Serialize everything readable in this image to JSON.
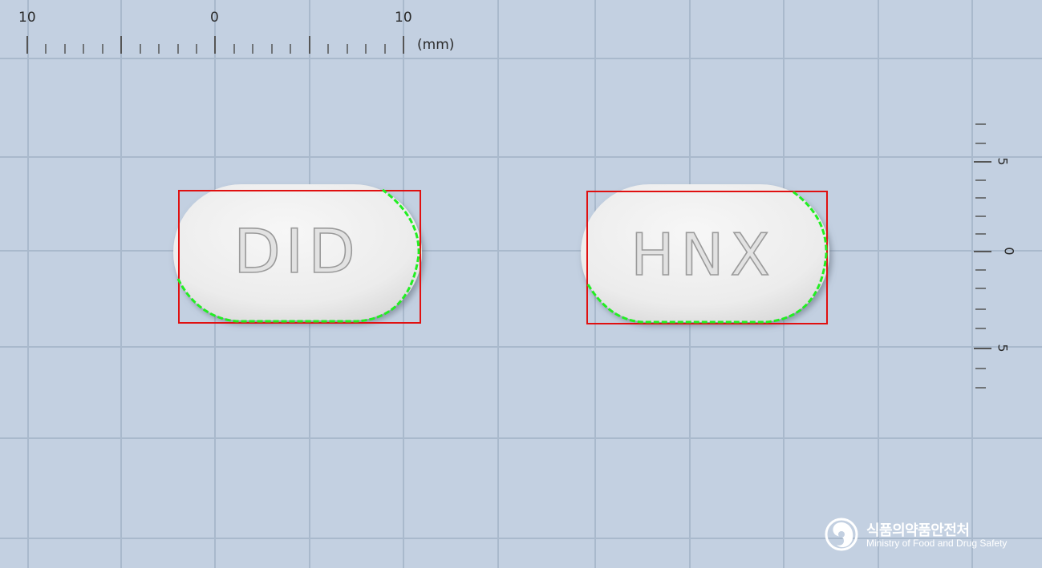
{
  "top_ruler": {
    "labels": [
      "10",
      "0",
      "10"
    ],
    "unit": "(mm)"
  },
  "side_ruler": {
    "labels": [
      "5",
      "0",
      "5"
    ]
  },
  "tablets": [
    {
      "imprint": "DID",
      "name": "tablet-left"
    },
    {
      "imprint": "HNX",
      "name": "tablet-right"
    }
  ],
  "colors": {
    "background": "#c3d0e1",
    "grid": "#a9b9cc",
    "tablet": "#efefef",
    "bounding_box": "#e01010",
    "contour": "#22ee22"
  },
  "logo": {
    "korean": "식품의약품안전처",
    "english": "Ministry of Food and Drug Safety"
  }
}
